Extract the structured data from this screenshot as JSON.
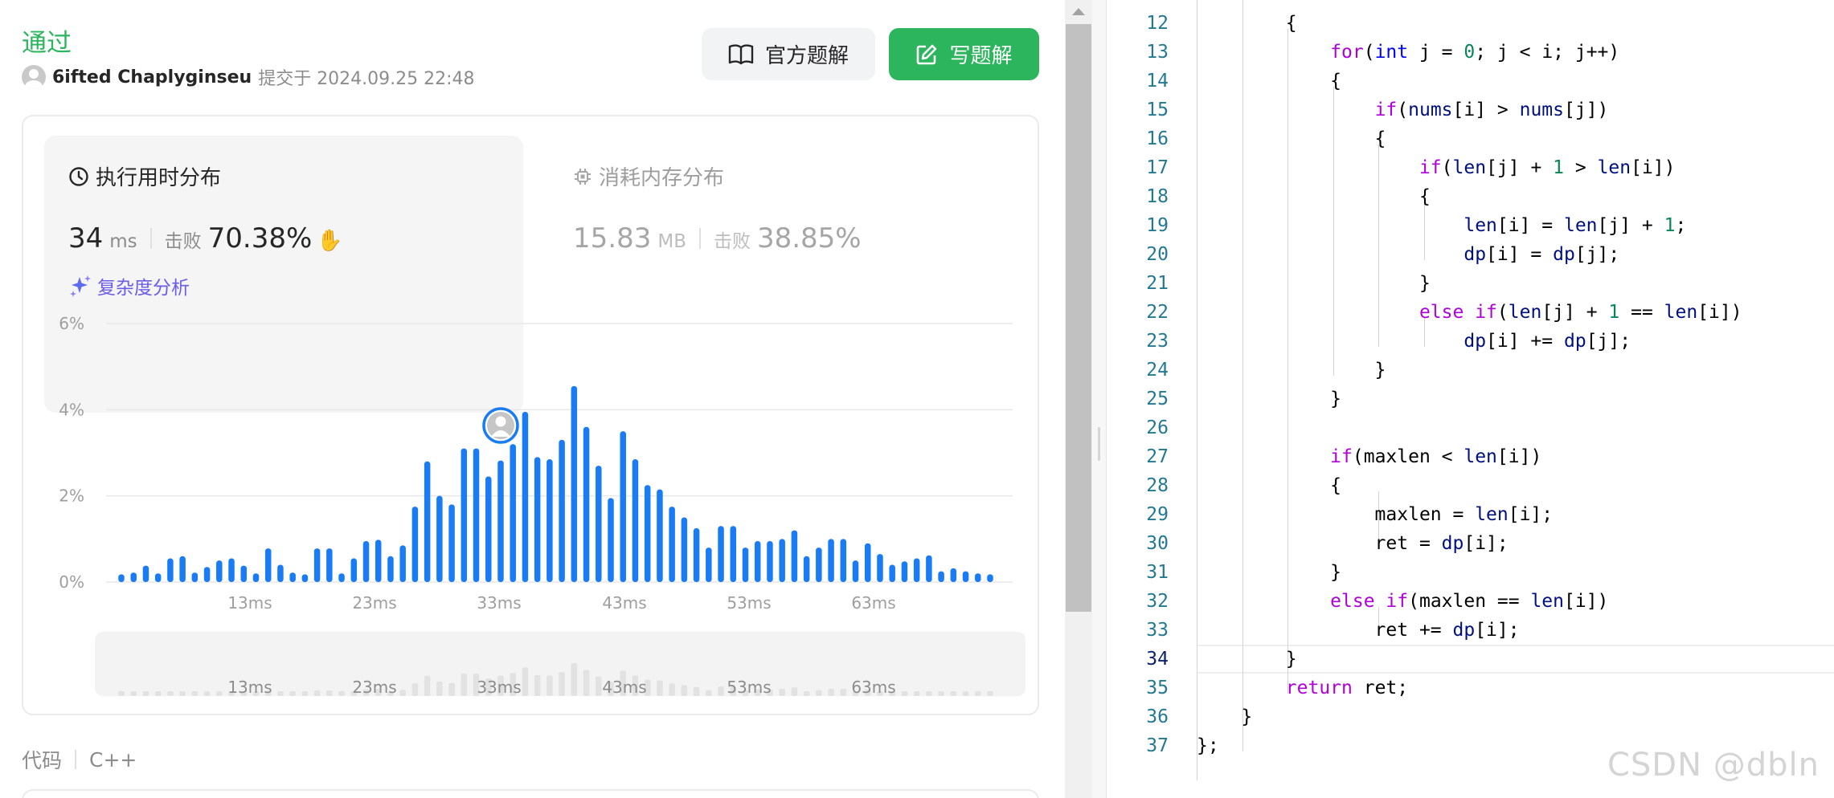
{
  "result": {
    "verdict": "通过",
    "user": "6ifted Chaplyginseu",
    "submitted_text": "提交于 2024.09.25 22:48"
  },
  "buttons": {
    "official_solution": "官方题解",
    "write_solution": "写题解"
  },
  "runtime": {
    "title": "执行用时分布",
    "value": "34",
    "unit": "ms",
    "beat_label": "击败",
    "beat_value": "70.38%",
    "complexity_link": "复杂度分析"
  },
  "memory": {
    "title": "消耗内存分布",
    "value": "15.83",
    "unit": "MB",
    "beat_label": "击败",
    "beat_value": "38.85%"
  },
  "chart_data": {
    "type": "bar",
    "title": "",
    "xlabel": "",
    "ylabel": "",
    "ylim": [
      0,
      6
    ],
    "y_ticks": [
      "0%",
      "2%",
      "4%",
      "6%"
    ],
    "x_tick_labels": [
      "13ms",
      "23ms",
      "33ms",
      "43ms",
      "53ms",
      "63ms"
    ],
    "bar_color": "#1a7cf5",
    "user_marker_bar_index": 31,
    "values": [
      0.18,
      0.22,
      0.38,
      0.2,
      0.55,
      0.6,
      0.22,
      0.35,
      0.5,
      0.55,
      0.38,
      0.2,
      0.78,
      0.4,
      0.22,
      0.18,
      0.78,
      0.78,
      0.2,
      0.55,
      0.95,
      0.98,
      0.6,
      0.85,
      1.75,
      2.8,
      2.0,
      1.8,
      3.1,
      3.1,
      2.45,
      2.82,
      3.2,
      3.95,
      2.9,
      2.85,
      3.3,
      4.55,
      3.6,
      2.7,
      1.95,
      3.5,
      2.85,
      2.25,
      2.15,
      1.75,
      1.5,
      1.25,
      0.8,
      1.3,
      1.3,
      0.8,
      0.95,
      0.95,
      1.0,
      1.2,
      0.6,
      0.8,
      1.0,
      1.0,
      0.5,
      0.9,
      0.65,
      0.4,
      0.48,
      0.55,
      0.62,
      0.25,
      0.32,
      0.25,
      0.2,
      0.18
    ]
  },
  "minimap": {
    "x_tick_labels": [
      "13ms",
      "23ms",
      "33ms",
      "43ms",
      "53ms",
      "63ms"
    ]
  },
  "code_section": {
    "label": "代码",
    "language": "C++"
  },
  "editor": {
    "lines": [
      {
        "n": "12",
        "html": "        {"
      },
      {
        "n": "13",
        "html": "            <span class=\"kw\">for</span>(<span class=\"ty\">int</span> j = <span class=\"nm\">0</span>; j &lt; i; j++)"
      },
      {
        "n": "14",
        "html": "            {"
      },
      {
        "n": "15",
        "html": "                <span class=\"kw\">if</span>(<span class=\"vr\">nums</span>[i] &gt; <span class=\"vr\">nums</span>[j])"
      },
      {
        "n": "16",
        "html": "                {"
      },
      {
        "n": "17",
        "html": "                    <span class=\"kw\">if</span>(<span class=\"vr\">len</span>[j] + <span class=\"nm\">1</span> &gt; <span class=\"vr\">len</span>[i])"
      },
      {
        "n": "18",
        "html": "                    {"
      },
      {
        "n": "19",
        "html": "                        <span class=\"vr\">len</span>[i] = <span class=\"vr\">len</span>[j] + <span class=\"nm\">1</span>;"
      },
      {
        "n": "20",
        "html": "                        <span class=\"vr\">dp</span>[i] = <span class=\"vr\">dp</span>[j];"
      },
      {
        "n": "21",
        "html": "                    }"
      },
      {
        "n": "22",
        "html": "                    <span class=\"kw\">else</span> <span class=\"kw\">if</span>(<span class=\"vr\">len</span>[j] + <span class=\"nm\">1</span> == <span class=\"vr\">len</span>[i])"
      },
      {
        "n": "23",
        "html": "                        <span class=\"vr\">dp</span>[i] += <span class=\"vr\">dp</span>[j];"
      },
      {
        "n": "24",
        "html": "                }"
      },
      {
        "n": "25",
        "html": "            }"
      },
      {
        "n": "26",
        "html": ""
      },
      {
        "n": "27",
        "html": "            <span class=\"kw\">if</span>(maxlen &lt; <span class=\"vr\">len</span>[i])"
      },
      {
        "n": "28",
        "html": "            {"
      },
      {
        "n": "29",
        "html": "                maxlen = <span class=\"vr\">len</span>[i];"
      },
      {
        "n": "30",
        "html": "                ret = <span class=\"vr\">dp</span>[i];"
      },
      {
        "n": "31",
        "html": "            }"
      },
      {
        "n": "32",
        "html": "            <span class=\"kw\">else</span> <span class=\"kw\">if</span>(maxlen == <span class=\"vr\">len</span>[i])"
      },
      {
        "n": "33",
        "html": "                ret += <span class=\"vr\">dp</span>[i];"
      },
      {
        "n": "34",
        "html": "        }"
      },
      {
        "n": "35",
        "html": "        <span class=\"kw\">return</span> ret;"
      },
      {
        "n": "36",
        "html": "    }"
      },
      {
        "n": "37",
        "html": "};"
      }
    ],
    "active_line": "34",
    "watermark": "CSDN @dbln"
  },
  "colors": {
    "accent_green": "#2db55d",
    "bar_blue": "#1a7cf5",
    "link_purple": "#6b5ce7"
  }
}
